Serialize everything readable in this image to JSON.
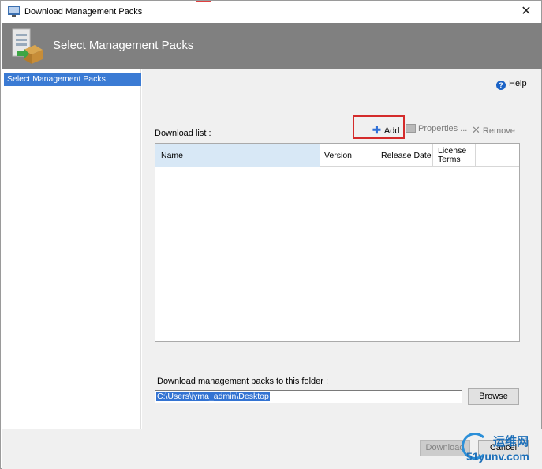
{
  "window": {
    "title": "Download Management Packs",
    "close_glyph": "✕"
  },
  "banner": {
    "title": "Select Management Packs",
    "icon": "management-pack-icon"
  },
  "nav": {
    "items": [
      {
        "label": "Select Management Packs",
        "selected": true
      }
    ]
  },
  "main": {
    "help_label": "Help",
    "download_list_label": "Download list :",
    "toolbar": {
      "add_label": "Add",
      "properties_label": "Properties ...",
      "remove_label": "Remove"
    },
    "list": {
      "columns": [
        "Name",
        "Version",
        "Release Date",
        "License Terms"
      ],
      "rows": []
    },
    "folder_label": "Download management packs to this folder :",
    "folder_value": "C:\\Users\\jyma_admin\\Desktop",
    "browse_label": "Browse"
  },
  "footer": {
    "download_label": "Download",
    "cancel_label": "Cancel"
  },
  "watermark": {
    "top": "运维网",
    "bottom": "51yunv.com"
  },
  "colors": {
    "banner": "#808080",
    "selection": "#3b7bd4",
    "highlight_box": "#d42b2b",
    "add_icon": "#2f6fd6"
  }
}
